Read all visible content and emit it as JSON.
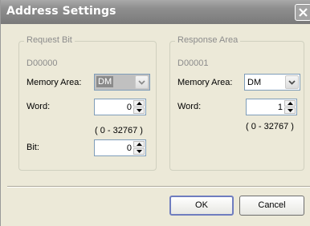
{
  "window": {
    "title": "Address Settings"
  },
  "request_bit": {
    "group_label": "Request Bit",
    "address": "D00000",
    "memory_area_label": "Memory Area:",
    "memory_area_value": "DM",
    "word_label": "Word:",
    "word_value": "0",
    "word_range": "( 0 - 32767 )",
    "bit_label": "Bit:",
    "bit_value": "0"
  },
  "response_area": {
    "group_label": "Response Area",
    "address": "D00001",
    "memory_area_label": "Memory Area:",
    "memory_area_value": "DM",
    "word_label": "Word:",
    "word_value": "1",
    "word_range": "( 0 - 32767 )"
  },
  "buttons": {
    "ok": "OK",
    "cancel": "Cancel"
  },
  "icons": {
    "close": "close-icon",
    "dropdown": "chevron-down-icon",
    "spin_up": "spin-up-icon",
    "spin_down": "spin-down-icon"
  }
}
